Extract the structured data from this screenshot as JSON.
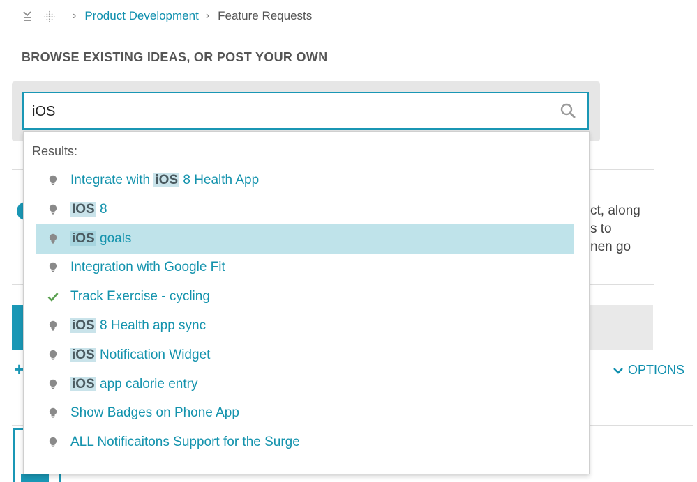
{
  "breadcrumb": {
    "items": [
      {
        "label": "Product Development",
        "link": true
      },
      {
        "label": "Feature Requests",
        "link": false
      }
    ]
  },
  "section_title": "BROWSE EXISTING IDEAS, OR POST YOUR OWN",
  "search": {
    "value": "iOS"
  },
  "results": {
    "label": "Results:",
    "items": [
      {
        "pre": "Integrate with ",
        "hl": "iOS",
        "post": " 8 Health App",
        "icon": "lightbulb-icon",
        "selected": false
      },
      {
        "pre": "",
        "hl": "IOS",
        "post": " 8",
        "icon": "lightbulb-icon",
        "selected": false
      },
      {
        "pre": "",
        "hl": "iOS",
        "post": " goals",
        "icon": "lightbulb-icon",
        "selected": true
      },
      {
        "pre": "Integration with Google Fit",
        "hl": "",
        "post": "",
        "icon": "lightbulb-icon",
        "selected": false
      },
      {
        "pre": "Track Exercise - cycling",
        "hl": "",
        "post": "",
        "icon": "checkmark-icon",
        "selected": false
      },
      {
        "pre": "",
        "hl": "iOS",
        "post": " 8 Health app sync",
        "icon": "lightbulb-icon",
        "selected": false
      },
      {
        "pre": "",
        "hl": "iOS",
        "post": " Notification Widget",
        "icon": "lightbulb-icon",
        "selected": false
      },
      {
        "pre": "",
        "hl": "iOS",
        "post": " app calorie entry",
        "icon": "lightbulb-icon",
        "selected": false
      },
      {
        "pre": "Show Badges on Phone App",
        "hl": "",
        "post": "",
        "icon": "lightbulb-icon",
        "selected": false
      },
      {
        "pre": "ALL Notificaitons Support for the Surge",
        "hl": "",
        "post": "",
        "icon": "lightbulb-icon",
        "selected": false
      }
    ]
  },
  "background": {
    "text_lines": [
      "ct, along",
      "s to",
      "nen go"
    ],
    "options_label": "OPTIONS",
    "plus": "+"
  },
  "colors": {
    "accent": "#1a97b5",
    "link": "#1493ad",
    "selected_row": "#bfe3ea",
    "check": "#5aa050",
    "bulb": "#8a8a8a"
  }
}
